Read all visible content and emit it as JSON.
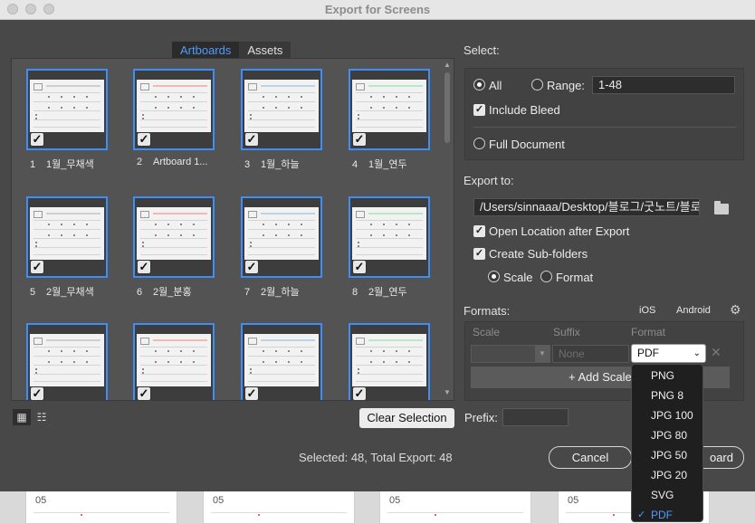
{
  "window": {
    "title": "Export for Screens"
  },
  "tabs": [
    {
      "label": "Artboards",
      "active": true
    },
    {
      "label": "Assets",
      "active": false
    }
  ],
  "artboards": [
    {
      "num": "1",
      "name": "1월_무채색",
      "accent": "#cfcfcf"
    },
    {
      "num": "2",
      "name": "Artboard 1...",
      "accent": "#f2b8b8"
    },
    {
      "num": "3",
      "name": "1월_하늘",
      "accent": "#bcd3e8"
    },
    {
      "num": "4",
      "name": "1월_연두",
      "accent": "#b8e8c6"
    },
    {
      "num": "5",
      "name": "2월_무채색",
      "accent": "#cfcfcf"
    },
    {
      "num": "6",
      "name": "2월_분홍",
      "accent": "#f2b8b8"
    },
    {
      "num": "7",
      "name": "2월_하늘",
      "accent": "#bcd3e8"
    },
    {
      "num": "8",
      "name": "2월_연두",
      "accent": "#b8e8c6"
    },
    {
      "num": "",
      "name": "",
      "accent": "#cfcfcf"
    },
    {
      "num": "",
      "name": "",
      "accent": "#f2b8b8"
    },
    {
      "num": "",
      "name": "",
      "accent": "#bcd3e8"
    },
    {
      "num": "",
      "name": "",
      "accent": "#b8e8c6"
    }
  ],
  "bottom": {
    "clear_selection": "Clear Selection",
    "summary": "Selected: 48, Total Export: 48",
    "cancel": "Cancel",
    "export_tail": "oard"
  },
  "select": {
    "label": "Select:",
    "all": "All",
    "range": "Range:",
    "range_value": "1-48",
    "include_bleed": "Include Bleed",
    "full_document": "Full Document"
  },
  "export_to": {
    "label": "Export to:",
    "path": "/Users/sinnaaa/Desktop/블로그/굿노트/블로",
    "open_location": "Open Location after Export",
    "create_subfolders": "Create Sub-folders",
    "scale": "Scale",
    "format": "Format"
  },
  "formats": {
    "label": "Formats:",
    "ios": "iOS",
    "android": "Android",
    "col_scale": "Scale",
    "col_suffix": "Suffix",
    "col_format": "Format",
    "suffix_placeholder": "None",
    "selected_format": "PDF",
    "add_scale": "+ Add Scale",
    "prefix": "Prefix:"
  },
  "dropdown": {
    "options": [
      "PNG",
      "PNG 8",
      "JPG 100",
      "JPG 80",
      "JPG 50",
      "JPG 20",
      "SVG",
      "PDF"
    ],
    "selected": "PDF"
  },
  "background": {
    "page_labels": [
      "05",
      "05",
      "05",
      "05"
    ]
  },
  "colors": {
    "accent_blue": "#4f9bff",
    "selection_border": "#3f8ef5",
    "panel_bg": "#484848"
  }
}
